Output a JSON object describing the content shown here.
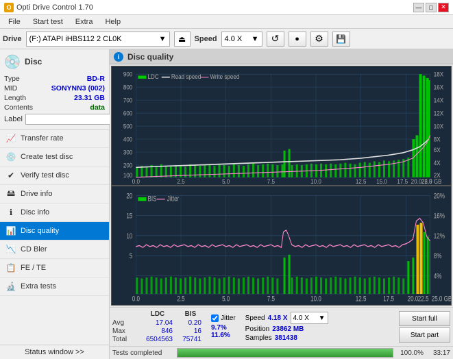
{
  "titlebar": {
    "icon": "O",
    "title": "Opti Drive Control 1.70",
    "controls": [
      "—",
      "□",
      "✕"
    ]
  },
  "menubar": {
    "items": [
      "File",
      "Start test",
      "Extra",
      "Help"
    ]
  },
  "drivebar": {
    "label": "Drive",
    "drive_value": "(F:)  ATAPI iHBS112  2 CL0K",
    "eject_icon": "⏏",
    "speed_label": "Speed",
    "speed_value": "4.0 X",
    "icon_refresh": "↺",
    "icon_burn": "🔴",
    "icon_config": "⚙",
    "icon_save": "💾"
  },
  "disc": {
    "label": "Disc",
    "type_key": "Type",
    "type_val": "BD-R",
    "mid_key": "MID",
    "mid_val": "SONYNN3 (002)",
    "length_key": "Length",
    "length_val": "23.31 GB",
    "contents_key": "Contents",
    "contents_val": "data",
    "label_key": "Label",
    "label_val": ""
  },
  "nav": {
    "items": [
      {
        "id": "transfer-rate",
        "label": "Transfer rate",
        "icon": "📈"
      },
      {
        "id": "create-test-disc",
        "label": "Create test disc",
        "icon": "💿"
      },
      {
        "id": "verify-test-disc",
        "label": "Verify test disc",
        "icon": "✔"
      },
      {
        "id": "drive-info",
        "label": "Drive info",
        "icon": "🖴"
      },
      {
        "id": "disc-info",
        "label": "Disc info",
        "icon": "ℹ"
      },
      {
        "id": "disc-quality",
        "label": "Disc quality",
        "icon": "📊",
        "active": true
      },
      {
        "id": "cd-bler",
        "label": "CD Bler",
        "icon": "📉"
      },
      {
        "id": "fe-te",
        "label": "FE / TE",
        "icon": "📋"
      },
      {
        "id": "extra-tests",
        "label": "Extra tests",
        "icon": "🔬"
      }
    ],
    "status_window": "Status window >>"
  },
  "quality": {
    "panel_title": "Disc quality",
    "panel_icon": "i",
    "chart1": {
      "legend": [
        "LDC",
        "Read speed",
        "Write speed"
      ],
      "y_max": 900,
      "y_right_max": 18,
      "x_max": 25,
      "x_label": "GB"
    },
    "chart2": {
      "legend": [
        "BIS",
        "Jitter"
      ],
      "y_max": 20,
      "y_right_max": "20%",
      "x_max": 25,
      "x_label": "GB"
    }
  },
  "stats": {
    "col_ldc": "LDC",
    "col_bis": "BIS",
    "col_jitter_label": "Jitter",
    "col_speed_label": "Speed",
    "col_speed_val": "4.18 X",
    "speed_dropdown": "4.0 X",
    "rows": [
      {
        "label": "Avg",
        "ldc": "17.04",
        "bis": "0.20",
        "jitter": "9.7%"
      },
      {
        "label": "Max",
        "ldc": "846",
        "bis": "16",
        "jitter": "11.6%"
      },
      {
        "label": "Total",
        "ldc": "6504563",
        "bis": "75741",
        "jitter": ""
      }
    ],
    "position_label": "Position",
    "position_val": "23862 MB",
    "samples_label": "Samples",
    "samples_val": "381438",
    "jitter_checked": true,
    "btn_start_full": "Start full",
    "btn_start_part": "Start part"
  },
  "statusbar": {
    "text": "Tests completed",
    "progress_pct": "100.0%",
    "progress_value": 100,
    "time": "33:17"
  }
}
